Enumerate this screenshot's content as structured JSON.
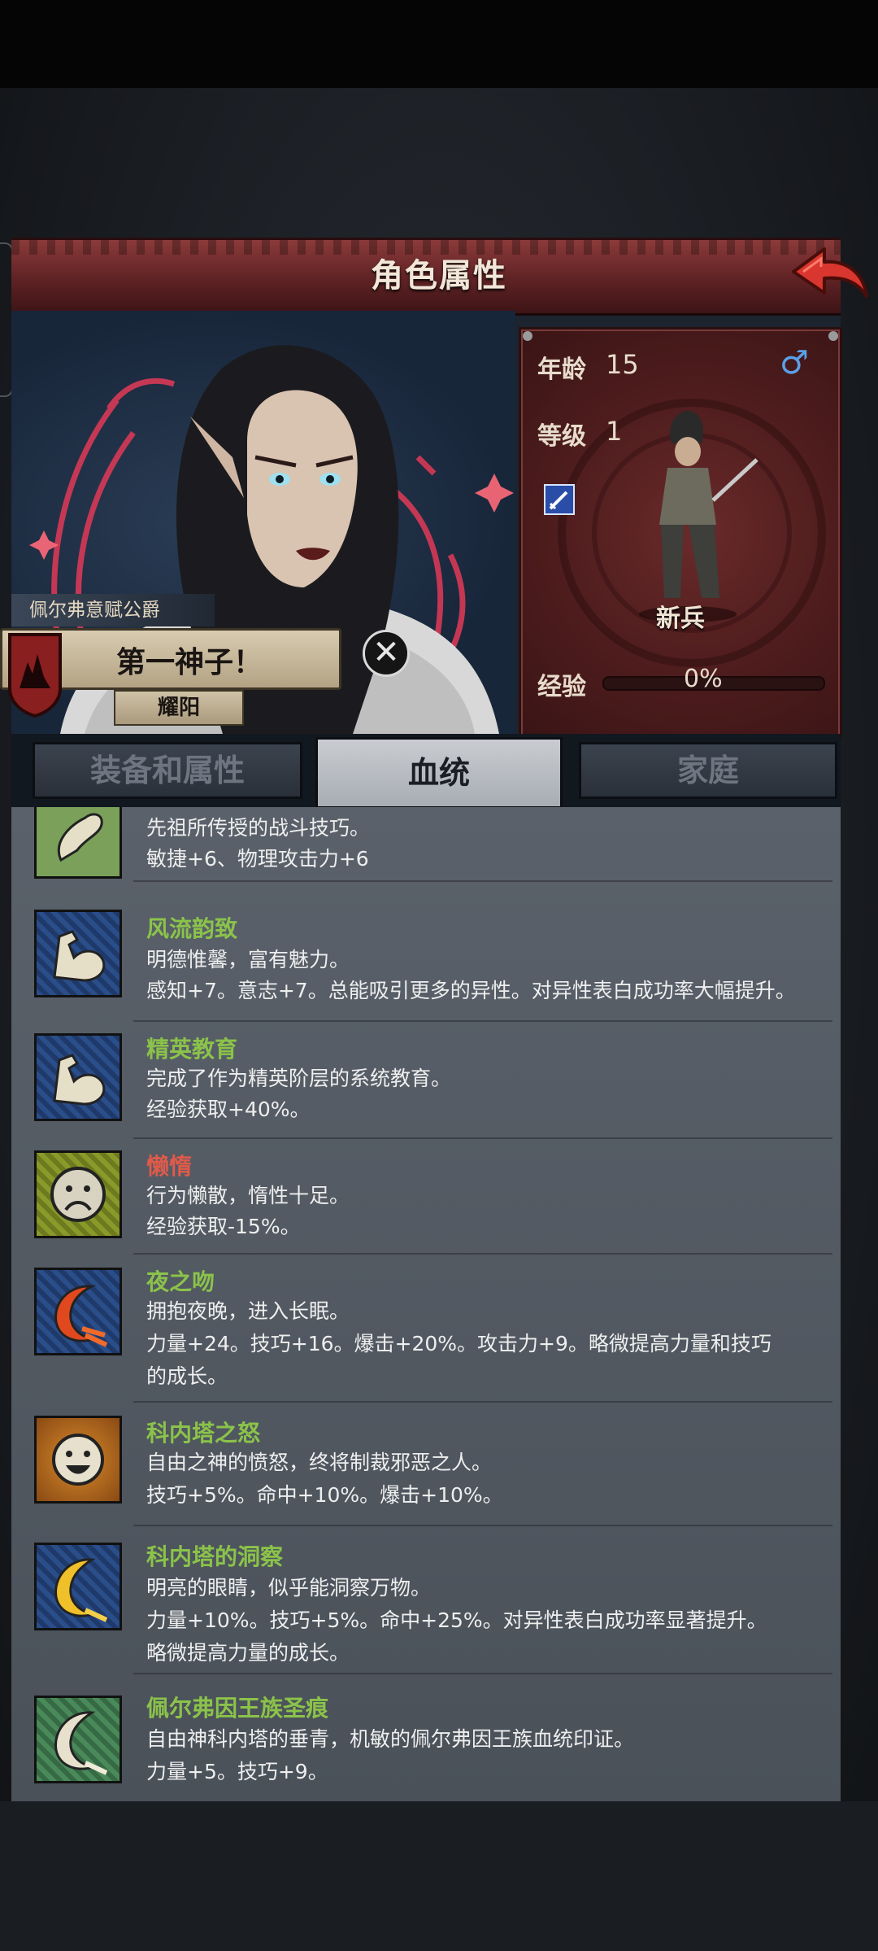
{
  "header": {
    "title": "角色属性"
  },
  "character": {
    "title_label": "佩尔弗意赋公爵",
    "nickname": "第一神子！",
    "house": "耀阳",
    "stats": {
      "age_label": "年龄",
      "age": "15",
      "level_label": "等级",
      "level": "1",
      "class_name": "新兵",
      "exp_label": "经验",
      "exp_value": "0%"
    },
    "gender_icon": "male-symbol"
  },
  "tabs": [
    {
      "label": "装备和属性",
      "active": false
    },
    {
      "label": "血统",
      "active": true
    },
    {
      "label": "家庭",
      "active": false
    }
  ],
  "traits": [
    {
      "name": "",
      "lines": [
        "先祖所传授的战斗技巧。",
        "敏捷+6、物理攻击力+6"
      ],
      "icon": "bone-arm-icon",
      "tone": "good"
    },
    {
      "name": "风流韵致",
      "lines": [
        "明德惟馨，富有魅力。",
        "感知+7。意志+7。总能吸引更多的异性。对异性表白成功率大幅提升。"
      ],
      "icon": "flexed-arm-icon",
      "tone": "good"
    },
    {
      "name": "精英教育",
      "lines": [
        "完成了作为精英阶层的系统教育。",
        "经验获取+40%。"
      ],
      "icon": "flexed-arm-icon",
      "tone": "good"
    },
    {
      "name": "懒惰",
      "lines": [
        "行为懒散，惰性十足。",
        "经验获取-15%。"
      ],
      "icon": "sad-face-icon",
      "tone": "bad"
    },
    {
      "name": "夜之吻",
      "lines": [
        "拥抱夜晚，进入长眠。",
        "力量+24。技巧+16。爆击+20%。攻击力+9。略微提高力量和技巧",
        "的成长。"
      ],
      "icon": "red-crescent-icon",
      "tone": "good"
    },
    {
      "name": "科内塔之怒",
      "lines": [
        "自由之神的愤怒，终将制裁邪恶之人。",
        "技巧+5%。命中+10%。爆击+10%。"
      ],
      "icon": "sun-face-icon",
      "tone": "good"
    },
    {
      "name": "科内塔的洞察",
      "lines": [
        "明亮的眼睛，似乎能洞察万物。",
        "力量+10%。技巧+5%。命中+25%。对异性表白成功率显著提升。",
        "略微提高力量的成长。"
      ],
      "icon": "gold-crescent-icon",
      "tone": "good"
    },
    {
      "name": "佩尔弗因王族圣痕",
      "lines": [
        "自由神科内塔的垂青，机敏的佩尔弗因王族血统印证。",
        "力量+5。技巧+9。"
      ],
      "icon": "white-crescent-icon",
      "tone": "good"
    }
  ]
}
